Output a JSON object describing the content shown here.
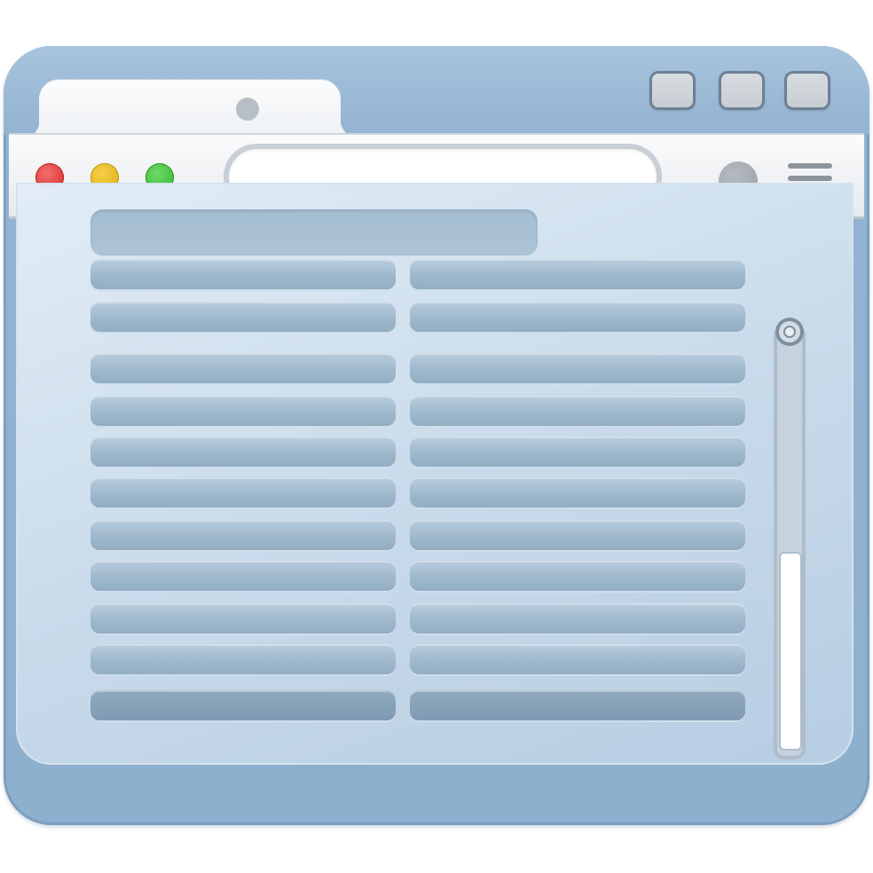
{
  "window": {
    "tab": {
      "title": "",
      "icon": "tab-favicon-dot"
    },
    "window_controls": [
      {
        "name": "minimize",
        "icon": "minimize-button"
      },
      {
        "name": "maximize",
        "icon": "maximize-button"
      },
      {
        "name": "close",
        "icon": "close-button"
      }
    ]
  },
  "toolbar": {
    "traffic_lights": [
      {
        "name": "close",
        "color": "#d92b2b"
      },
      {
        "name": "minimize",
        "color": "#e0ad12"
      },
      {
        "name": "zoom",
        "color": "#2fb52a"
      }
    ],
    "address_bar": {
      "value": "",
      "placeholder": ""
    },
    "profile_icon": "profile-circle-icon",
    "menu_icon": "hamburger-menu-icon"
  },
  "content": {
    "heading": "",
    "rows_left_count_note": "",
    "scrollbar": {
      "position_fraction": 0.55
    }
  },
  "colors": {
    "frame": "#93b4d2",
    "content_bg": "#c9dbeb",
    "row": "#9fb8cc",
    "toolbar": "#e7eaee"
  }
}
